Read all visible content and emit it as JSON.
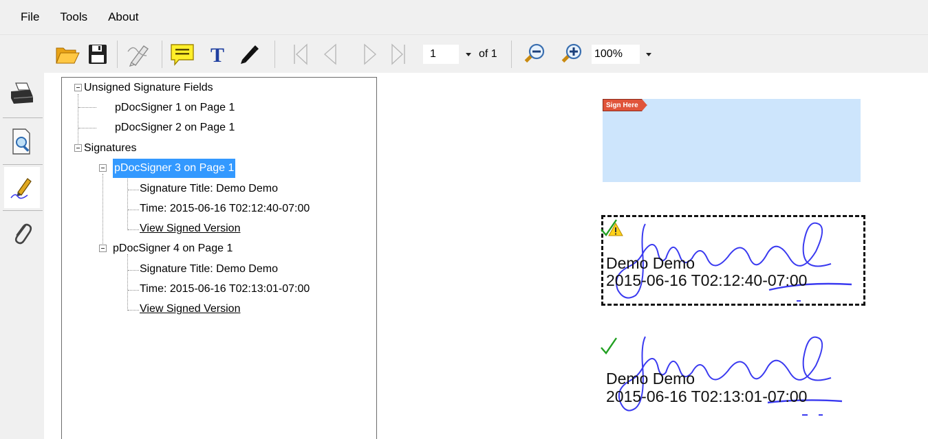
{
  "menu": {
    "file": "File",
    "tools": "Tools",
    "about": "About"
  },
  "toolbar": {
    "page_value": "1",
    "of_label": "of 1",
    "zoom_value": "100%",
    "icons": [
      "open-folder-icon",
      "save-icon",
      "sign-pen-icon",
      "comment-icon",
      "text-icon",
      "pencil-icon",
      "first-page-icon",
      "prev-page-icon",
      "next-page-icon",
      "last-page-icon",
      "zoom-out-icon",
      "zoom-in-icon"
    ]
  },
  "sidebar": {
    "icons": [
      "printer-icon",
      "search-document-icon",
      "signature-pen-icon",
      "paperclip-icon"
    ]
  },
  "tree": {
    "unsigned_header": "Unsigned Signature Fields",
    "unsigned_items": [
      "pDocSigner 1 on Page 1",
      "pDocSigner 2 on Page 1"
    ],
    "signatures_header": "Signatures",
    "signatures": [
      {
        "label": "pDocSigner 3 on Page 1",
        "title": "Signature Title: Demo Demo",
        "time": "Time: 2015-06-16 T02:12:40-07:00",
        "link": "View Signed Version"
      },
      {
        "label": "pDocSigner 4 on Page 1",
        "title": "Signature Title: Demo Demo",
        "time": "Time: 2015-06-16 T02:13:01-07:00",
        "link": "View Signed Version"
      }
    ]
  },
  "document": {
    "sign_here_tag": "Sign Here",
    "sig1": {
      "name": "Demo Demo",
      "date": "2015-06-16 T02:12:40-07:00"
    },
    "sig2": {
      "name": "Demo Demo",
      "date": "2015-06-16 T02:13:01-07:00"
    }
  },
  "colors": {
    "selection": "#3399ff",
    "sign_field": "#cde5fc",
    "sign_tag": "#e0543a",
    "ink": "#3a3af0",
    "check": "#22a022"
  }
}
